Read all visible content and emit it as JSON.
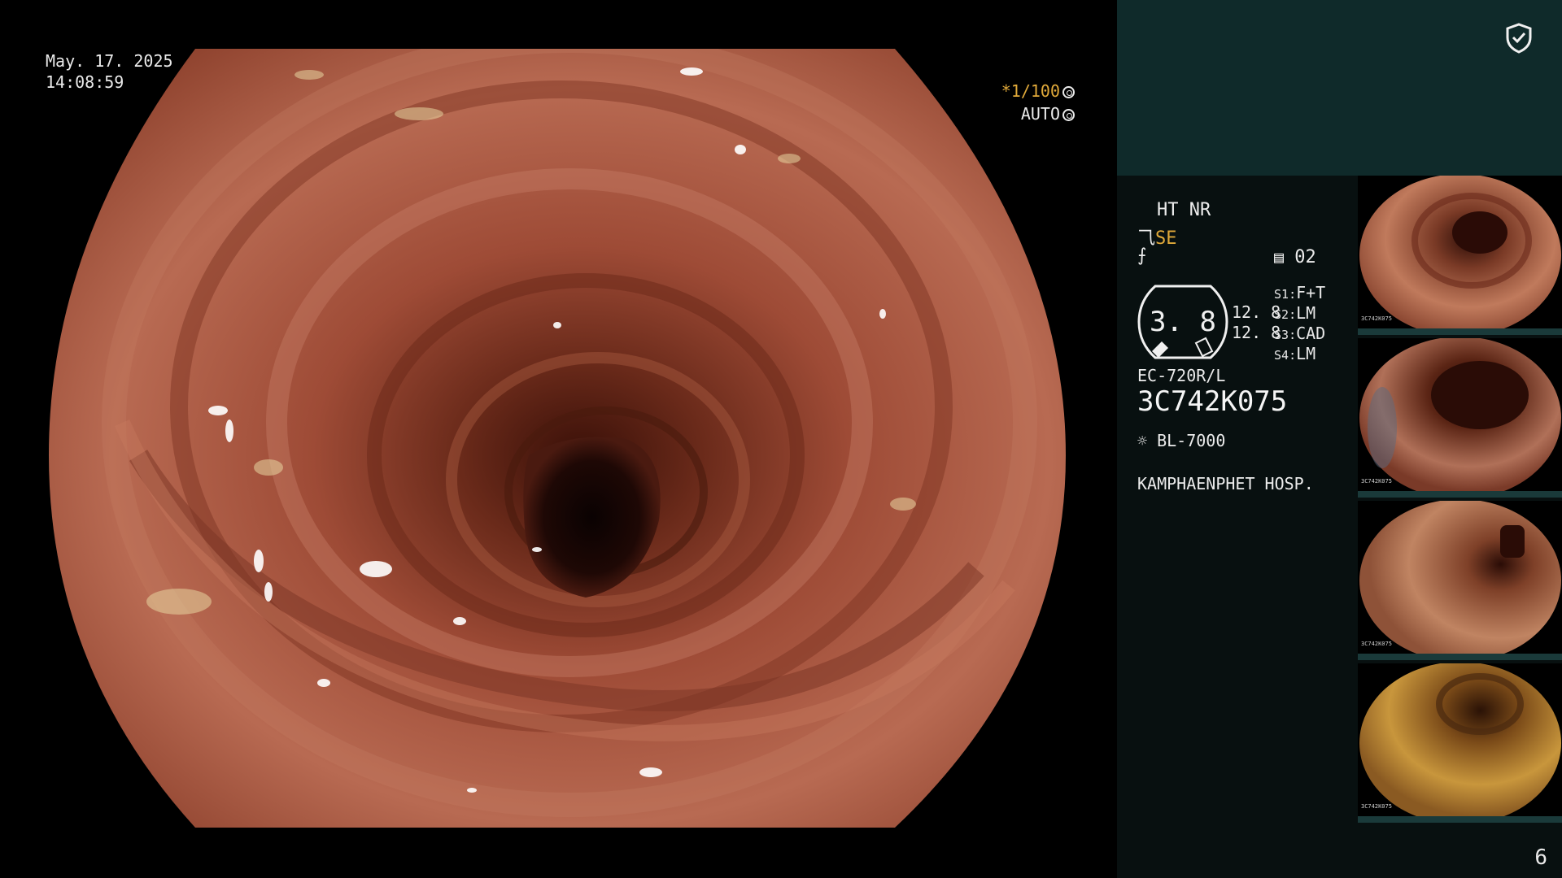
{
  "osd": {
    "date": "May. 17. 2025",
    "time": "14:08:59",
    "shutter_prefix": "*",
    "shutter": "1/100",
    "iris_mode": "AUTO"
  },
  "panel": {
    "mode_line": "HT NR",
    "structure_mode": "SE",
    "memory_slot": "02",
    "enhance_value": "3. 8",
    "enhance_top": "12. 8",
    "enhance_bottom": "12. 8",
    "switches": [
      {
        "key": "S1",
        "value": "F+T"
      },
      {
        "key": "S2",
        "value": "LM"
      },
      {
        "key": "S3",
        "value": "CAD"
      },
      {
        "key": "S4",
        "value": "LM"
      }
    ],
    "scope_model": "EC-720R/L",
    "scope_serial": "3C742K075",
    "light_source": "BL-7000",
    "hospital": "KAMPHAENPHET HOSP.",
    "page_number": "6"
  },
  "thumbnails": [
    {
      "id": 1,
      "serial": "3C742K075"
    },
    {
      "id": 2,
      "serial": "3C742K075"
    },
    {
      "id": 3,
      "serial": "3C742K075"
    },
    {
      "id": 4,
      "serial": "3C742K075"
    }
  ],
  "colors": {
    "panel_bg": "#081010",
    "panel_top": "#0f2a2a",
    "accent": "#e0a93a",
    "mucosa": "#a8553d"
  }
}
